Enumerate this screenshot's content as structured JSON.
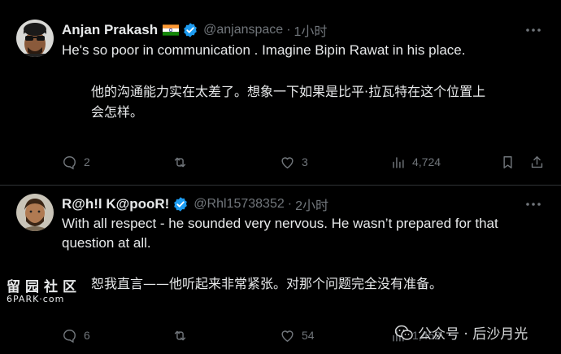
{
  "tweets": [
    {
      "name": "Anjan Prakash",
      "flag": "🇮🇳",
      "handle": "@anjanspace",
      "time": "1小时",
      "text_en": "He's so poor in communication . Imagine Bipin Rawat in his place.",
      "text_zh_line1": "他的沟通能力实在太差了。想象一下如果是比平·拉瓦特在这个位置上",
      "text_zh_line2": "会怎样。",
      "replies": "2",
      "retweets": "",
      "likes": "3",
      "views": "4,724"
    },
    {
      "name": "R@h!l K@pooR!",
      "handle": "@Rhl15738352",
      "time": "2小时",
      "text_en_line1": "With all respect - he sounded very nervous. He wasn’t prepared for that",
      "text_en_line2": "question at all.",
      "text_zh": "恕我直言——他听起来非常紧张。对那个问题完全没有准备。",
      "replies": "6",
      "retweets": "",
      "likes": "54",
      "views": "1,452"
    }
  ],
  "separator": "·",
  "watermarks": {
    "left_cn": "留园社区",
    "left_en": "6PARK·com",
    "right": "公众号 · 后沙月光"
  },
  "colors": {
    "background": "#000000",
    "text": "#e7e9ea",
    "secondary": "#71767b",
    "verified": "#1d9bf0",
    "divider": "#2f3336"
  }
}
